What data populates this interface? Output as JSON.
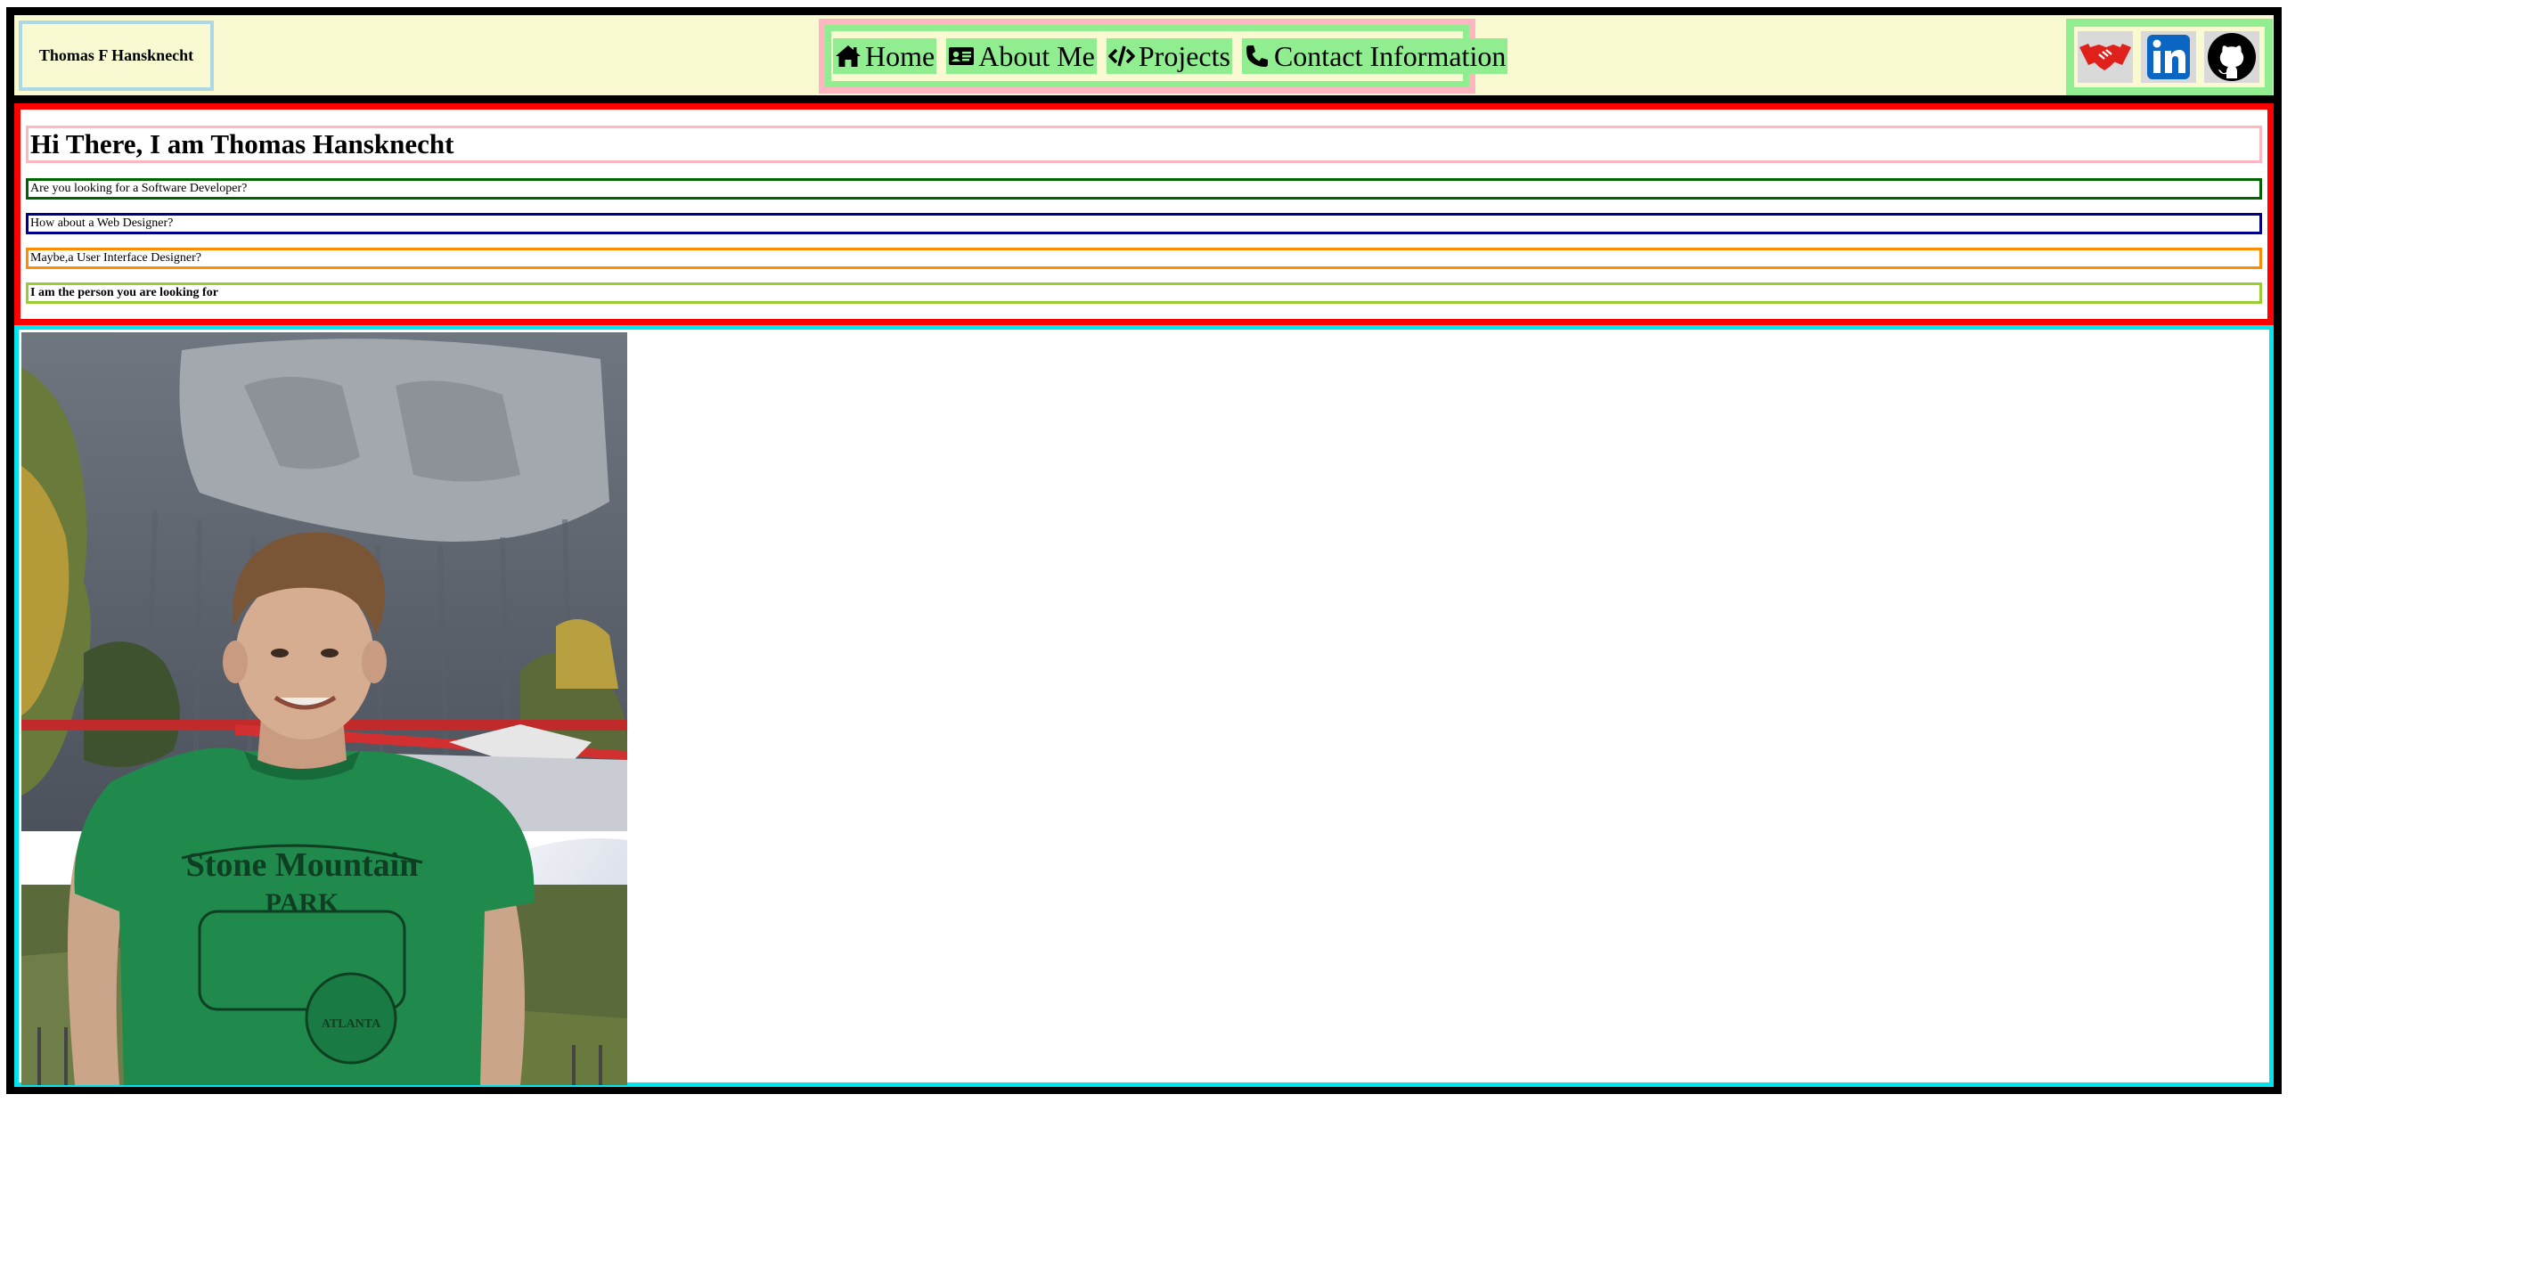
{
  "header": {
    "brand_name": "Thomas F Hansknecht",
    "nav": [
      {
        "label": "Home",
        "icon": "home-icon"
      },
      {
        "label": "About Me",
        "icon": "id-card-icon"
      },
      {
        "label": "Projects",
        "icon": "code-icon"
      },
      {
        "label": "Contact Information",
        "icon": "phone-icon"
      }
    ],
    "social": [
      {
        "icon": "handshake-icon",
        "color": "#e0201b"
      },
      {
        "icon": "linkedin-icon",
        "color": "#0a66c2"
      },
      {
        "icon": "github-icon",
        "color": "#000000"
      }
    ]
  },
  "intro": {
    "greeting": "Hi There, I am Thomas Hansknecht",
    "lines": [
      "Are you looking for a Software Developer?",
      "How about a Web Designer?",
      "Maybe,a User Interface Designer?",
      "I am the person you are looking for"
    ]
  },
  "photo": {
    "shirt_lines": [
      "Stone Mountain",
      "PARK",
      "ATLANTA"
    ]
  },
  "colors": {
    "header_bg": "#fafad2",
    "nav_border": "#ffb6c1",
    "nav_item_bg": "#90ee90",
    "intro_border": "#ff0000",
    "photo_border": "#00e5ee"
  }
}
